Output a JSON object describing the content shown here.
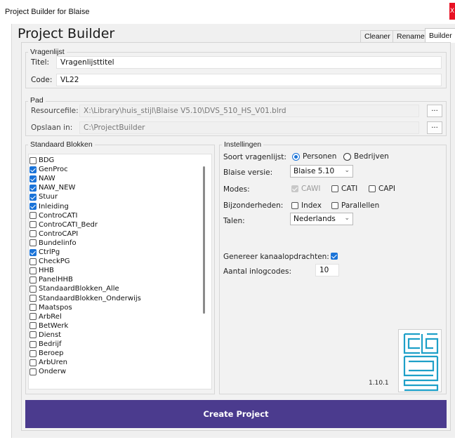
{
  "window": {
    "title": "Project Builder for Blaise",
    "close_label": "X"
  },
  "app": {
    "heading": "Project Builder"
  },
  "tabs": [
    {
      "label": "Cleaner",
      "active": false
    },
    {
      "label": "Renamer",
      "active": false
    },
    {
      "label": "Builder",
      "active": true
    }
  ],
  "vragenlijst": {
    "legend": "Vragenlijst",
    "titel_label": "Titel:",
    "titel_value": "Vragenlijsttitel",
    "code_label": "Code:",
    "code_value": "VL22"
  },
  "pad": {
    "legend": "Pad",
    "resourcefile_label": "Resourcefile:",
    "resourcefile_value": "X:\\Library\\huis_stijl\\Blaise V5.10\\DVS_510_HS_V01.blrd",
    "opslaan_label": "Opslaan in:",
    "opslaan_value": "C:\\ProjectBuilder",
    "browse_label": "..."
  },
  "blokken": {
    "legend": "Standaard Blokken",
    "items": [
      {
        "label": "BDG",
        "checked": false
      },
      {
        "label": "GenProc",
        "checked": true
      },
      {
        "label": "NAW",
        "checked": true
      },
      {
        "label": "NAW_NEW",
        "checked": true
      },
      {
        "label": "Stuur",
        "checked": true
      },
      {
        "label": "Inleiding",
        "checked": true
      },
      {
        "label": "ControCATI",
        "checked": false
      },
      {
        "label": "ControCATI_Bedr",
        "checked": false
      },
      {
        "label": "ControCAPI",
        "checked": false
      },
      {
        "label": "Bundelinfo",
        "checked": false
      },
      {
        "label": "CtrlPg",
        "checked": true
      },
      {
        "label": "CheckPG",
        "checked": false
      },
      {
        "label": "HHB",
        "checked": false
      },
      {
        "label": "PanelHHB",
        "checked": false
      },
      {
        "label": "StandaardBlokken_Alle",
        "checked": false
      },
      {
        "label": "StandaardBlokken_Onderwijs",
        "checked": false
      },
      {
        "label": "Maatspos",
        "checked": false
      },
      {
        "label": "ArbRel",
        "checked": false
      },
      {
        "label": "BetWerk",
        "checked": false
      },
      {
        "label": "Dienst",
        "checked": false
      },
      {
        "label": "Bedrijf",
        "checked": false
      },
      {
        "label": "Beroep",
        "checked": false
      },
      {
        "label": "ArbUren",
        "checked": false
      },
      {
        "label": "Onderw",
        "checked": false
      }
    ]
  },
  "instellingen": {
    "legend": "Instellingen",
    "soort_label": "Soort vragenlijst:",
    "soort_options": [
      {
        "label": "Personen",
        "selected": true
      },
      {
        "label": "Bedrijven",
        "selected": false
      }
    ],
    "versie_label": "Blaise versie:",
    "versie_value": "Blaise 5.10",
    "modes_label": "Modes:",
    "modes": [
      {
        "label": "CAWI",
        "checked": true,
        "disabled": true
      },
      {
        "label": "CATI",
        "checked": false,
        "disabled": false
      },
      {
        "label": "CAPI",
        "checked": false,
        "disabled": false
      }
    ],
    "bijzonderheden_label": "Bijzonderheden:",
    "bijzonderheden": [
      {
        "label": "Index",
        "checked": false
      },
      {
        "label": "Parallellen",
        "checked": false
      }
    ],
    "talen_label": "Talen:",
    "talen_value": "Nederlands",
    "kanaal_label": "Genereer kanaalopdrachten:",
    "kanaal_checked": true,
    "inlog_label": "Aantal inlogcodes:",
    "inlog_value": "10",
    "version": "1.10.1"
  },
  "create_button": {
    "label": "Create Project"
  },
  "colors": {
    "accent": "#1a73d8",
    "button": "#4b3b8e",
    "logo": "#1ea0c8"
  }
}
